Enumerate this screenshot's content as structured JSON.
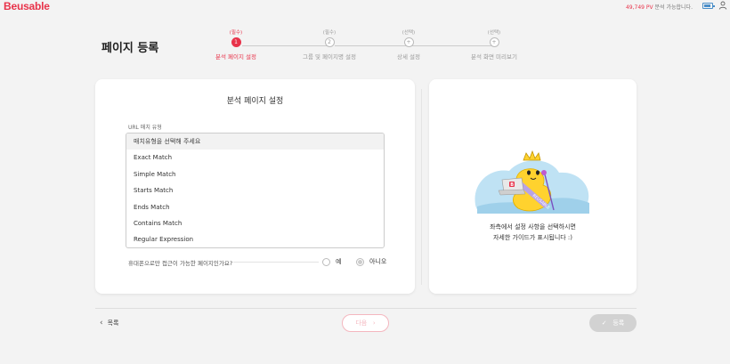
{
  "app": {
    "logo": "Beusable"
  },
  "header": {
    "pv_count": "49,749 PV",
    "pv_suffix": "분석 가능합니다."
  },
  "page": {
    "title": "페이지 등록"
  },
  "steps": [
    {
      "tag": "(필수)",
      "number": "1",
      "name": "분석 페이지 설정",
      "active": true
    },
    {
      "tag": "(필수)",
      "number": "2",
      "name": "그룹 및 페이지명 설정",
      "active": false
    },
    {
      "tag": "(선택)",
      "number": "+",
      "name": "상세 설정",
      "active": false
    },
    {
      "tag": "(선택)",
      "number": "+",
      "name": "분석 화면 미리보기",
      "active": false
    }
  ],
  "form": {
    "title": "분석 페이지 설정",
    "url_match_label": "URL 매치 유형",
    "dropdown_options": [
      "매치유형을 선택해 주세요",
      "Exact Match",
      "Simple Match",
      "Starts Match",
      "Ends Match",
      "Contains Match",
      "Regular Expression"
    ],
    "mobile_question": "휴대폰으로만 접근이 가능한 페이지인가요?",
    "radio_yes": "예",
    "radio_no": "아니오",
    "selected_radio": "no"
  },
  "guide": {
    "line1": "좌측에서 설정 사항을 선택하시면",
    "line2": "자세한 가이드가 표시됩니다 :)",
    "sash_text": "BEUSABLE",
    "laptop_badge": "B"
  },
  "footer": {
    "back_label": "목록",
    "next_label": "다음",
    "done_label": "등록"
  },
  "colors": {
    "accent": "#e8334a",
    "disabled": "#d2d2d2",
    "bg": "#f3f3f3"
  }
}
